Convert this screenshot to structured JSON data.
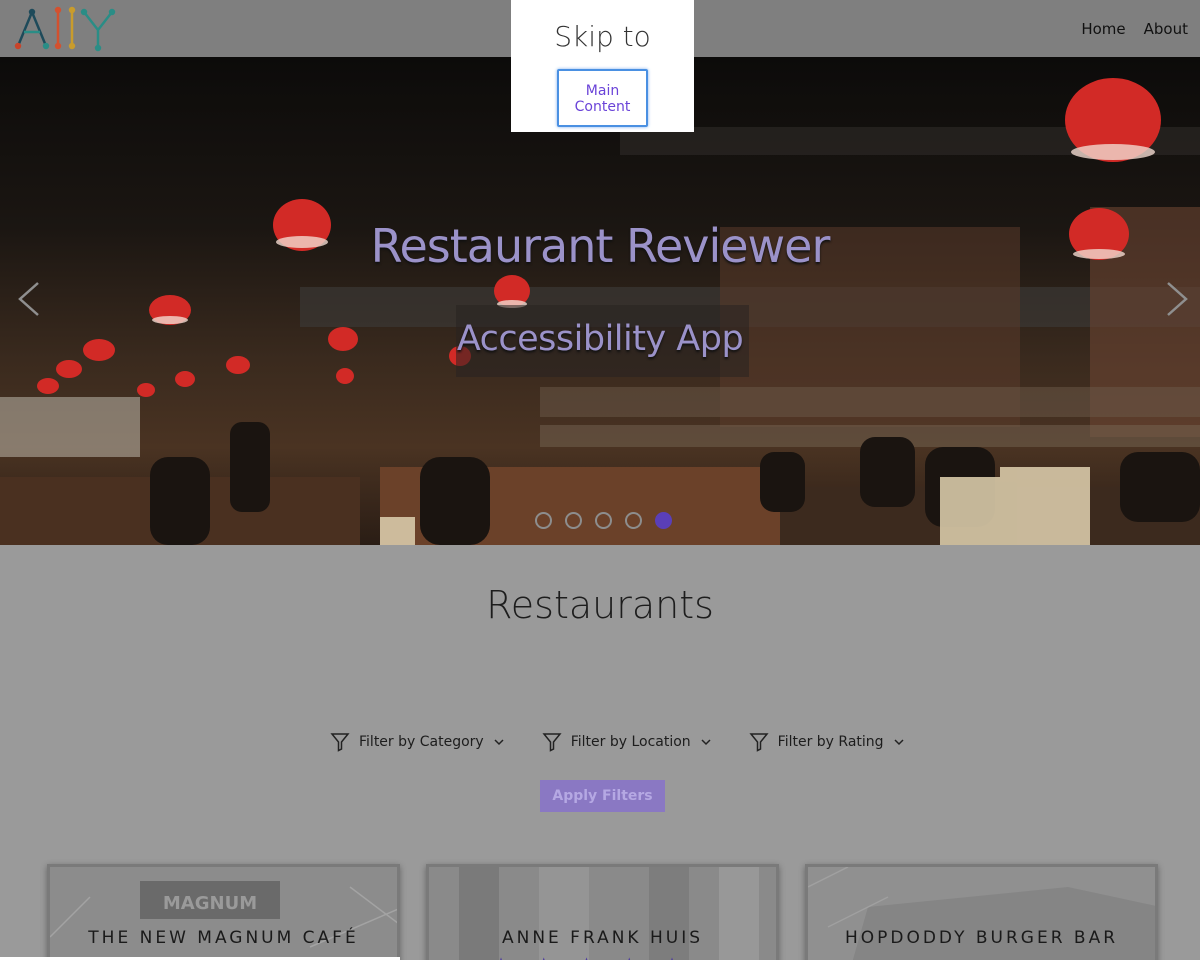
{
  "header": {
    "logo_text": "A11Y",
    "nav": [
      {
        "label": "Home"
      },
      {
        "label": "About"
      }
    ]
  },
  "skip_dialog": {
    "title": "Skip to",
    "link_label": "Main Content"
  },
  "hero": {
    "title": "Restaurant Reviewer",
    "subtitle": "Accessibility App",
    "slides_count": 5,
    "active_slide": 5
  },
  "main": {
    "title": "Restaurants",
    "filters": [
      {
        "label": "Filter by Category"
      },
      {
        "label": "Filter by Location"
      },
      {
        "label": "Filter by Rating"
      }
    ],
    "apply_label": "Apply Filters"
  },
  "cards": [
    {
      "title": "THE NEW MAGNUM CAFÉ",
      "image_text": "MAGNUM"
    },
    {
      "title": "ANNE FRANK HUIS",
      "image_text": ""
    },
    {
      "title": "HOPDODDY BURGER BAR",
      "image_text": ""
    }
  ],
  "colors": {
    "accent": "#5a3fb8",
    "link": "#6a43d8",
    "focus": "#4a90e2"
  }
}
